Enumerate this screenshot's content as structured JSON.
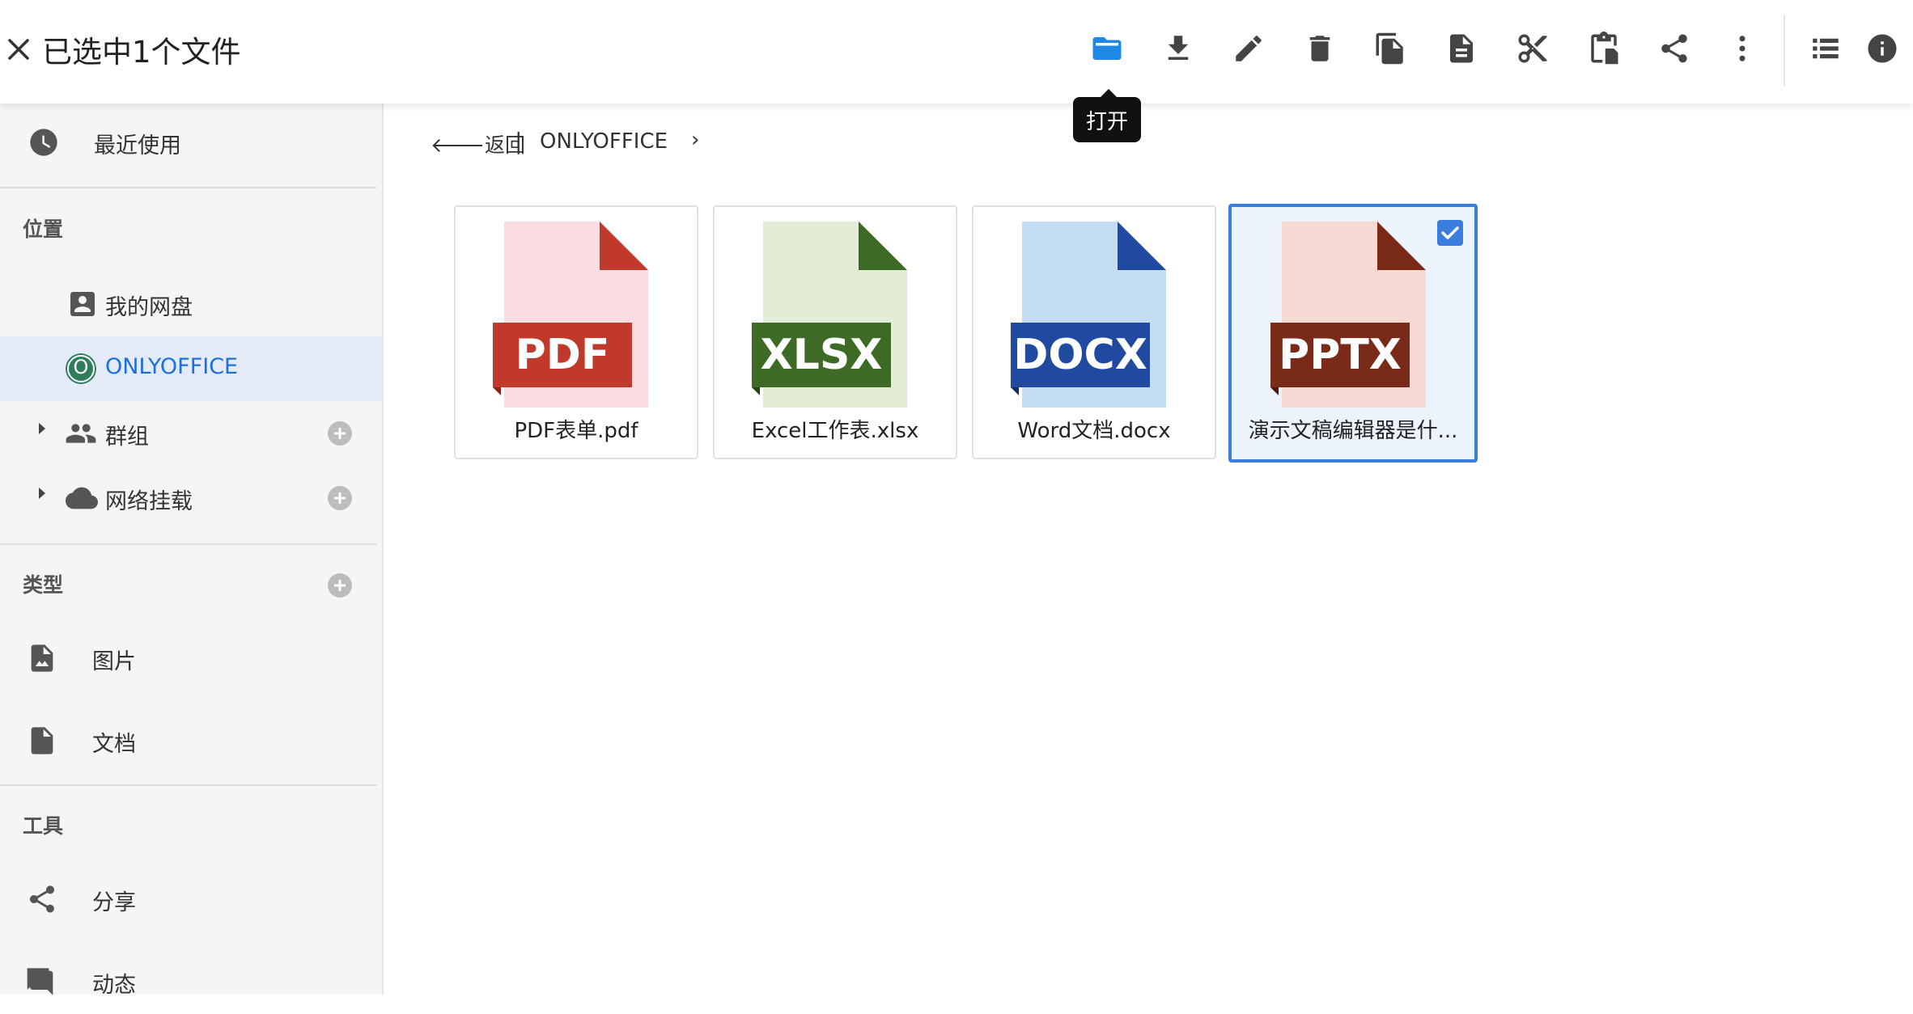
{
  "topbar": {
    "title": "已选中1个文件",
    "tooltip": "打开",
    "actions": [
      "open",
      "download",
      "rename",
      "delete",
      "copy",
      "details",
      "cut",
      "paste",
      "share",
      "more",
      "list-view",
      "info"
    ]
  },
  "sidebar": {
    "recent": "最近使用",
    "location_header": "位置",
    "my_drive": "我的网盘",
    "onlyoffice": "ONLYOFFICE",
    "onlyoffice_badge": "O",
    "groups": "群组",
    "network_mount": "网络挂载",
    "type_header": "类型",
    "images": "图片",
    "documents": "文档",
    "tools_header": "工具",
    "share": "分享",
    "activity": "动态"
  },
  "main": {
    "back": "返回",
    "separator": "|",
    "current_folder": "ONLYOFFICE",
    "chevron": "›",
    "files": [
      {
        "name": "PDF表单.pdf",
        "badge": "PDF",
        "selected": false
      },
      {
        "name": "Excel工作表.xlsx",
        "badge": "XLSX",
        "selected": false
      },
      {
        "name": "Word文档.docx",
        "badge": "DOCX",
        "selected": false
      },
      {
        "name": "演示文稿编辑器是什...",
        "badge": "PPTX",
        "selected": true
      }
    ]
  },
  "colors": {
    "accent": "#1e88e5",
    "selection": "#3c7de0",
    "pdf_page": "#f9dde0",
    "pdf_fold": "#c0392b",
    "pdf_banner": "#c0392b",
    "xlsx_page": "#e2ecd6",
    "xlsx_fold": "#3d6b26",
    "xlsx_banner": "#3d6b26",
    "docx_page": "#c5ddf4",
    "docx_fold": "#1f4aa0",
    "docx_banner": "#1f4aa0",
    "pptx_page": "#f6d9d3",
    "pptx_fold": "#7a2a18",
    "pptx_banner": "#7a2a18"
  }
}
